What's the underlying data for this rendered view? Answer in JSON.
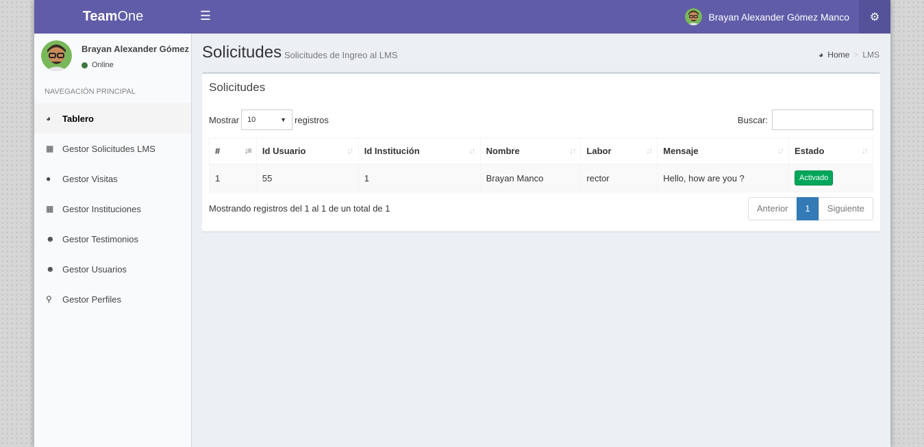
{
  "header": {
    "logo_bold": "Team",
    "logo_light": "One",
    "user_name": "Brayan Alexander Gómez Manco"
  },
  "sidebar": {
    "user_name": "Brayan Alexander Gómez Manco",
    "status": "Online",
    "nav_header": "NAVEGACIÓN PRINCIPAL",
    "items": [
      {
        "label": "Tablero",
        "icon": "dashboard-icon"
      },
      {
        "label": "Gestor Solicitudes LMS",
        "icon": "table-icon"
      },
      {
        "label": "Gestor Visitas",
        "icon": "map-marker-icon"
      },
      {
        "label": "Gestor Instituciones",
        "icon": "table-icon"
      },
      {
        "label": "Gestor Testimonios",
        "icon": "users-icon"
      },
      {
        "label": "Gestor Usuarios",
        "icon": "users-icon"
      },
      {
        "label": "Gestor Perfiles",
        "icon": "key-icon"
      }
    ]
  },
  "content": {
    "title": "Solicitudes",
    "subtitle": "Solicitudes de Ingreo al LMS",
    "breadcrumb": {
      "home": "Home",
      "current": "LMS"
    },
    "box_title": "Solicitudes",
    "length": {
      "prefix": "Mostrar",
      "value": "10",
      "suffix": "registros"
    },
    "search_label": "Buscar:",
    "table": {
      "headers": [
        "#",
        "Id Usuario",
        "Id Institución",
        "Nombre",
        "Labor",
        "Mensaje",
        "Estado"
      ],
      "rows": [
        {
          "num": "1",
          "id_usuario": "55",
          "id_institucion": "1",
          "nombre": "Brayan Manco",
          "labor": "rector",
          "mensaje": "Hello, how are you ?",
          "estado": "Activado"
        }
      ]
    },
    "info": "Mostrando registros del 1 al 1 de un total de 1",
    "pagination": {
      "prev": "Anterior",
      "current": "1",
      "next": "Siguiente"
    }
  },
  "colors": {
    "header": "#605ca8",
    "settings": "#555299",
    "badge": "#00a65a",
    "page_active": "#337ab7"
  }
}
